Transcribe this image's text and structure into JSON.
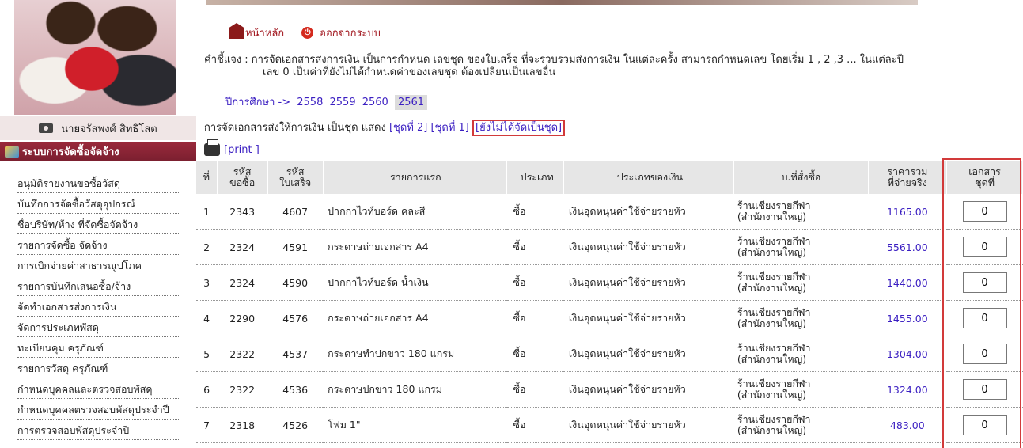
{
  "left": {
    "username": "นายจรัสพงศ์ สิทธิโสต",
    "menu_header": "ระบบการจัดซื้อจัดจ้าง",
    "menu": [
      "อนุมัติรายงานขอซื้อวัสดุ",
      "บันทึกการจัดซื้อวัสดุอุปกรณ์",
      "ชื่อบริษัท/ห้าง ที่จัดซื้อจัดจ้าง",
      "รายการจัดซื้อ จัดจ้าง",
      "การเบิกจ่ายค่าสาธารณูปโภค",
      "รายการบันทึกเสนอซื้อ/จ้าง",
      "จัดทำเอกสารส่งการเงิน",
      "จัดการประเภทพัสดุ",
      "ทะเบียนคุม ครุภัณฑ์",
      "รายการวัสดุ ครุภัณฑ์",
      "กำหนดบุคคลและตรวจสอบพัสดุ",
      "กำหนดบุคคลตรวจสอบพัสดุประจำปี",
      "การตรวจสอบพัสดุประจำปี"
    ]
  },
  "topnav": {
    "home": "หน้าหลัก",
    "logout": "ออกจากระบบ"
  },
  "explain": {
    "line1": "คำชี้แจง : การจัดเอกสารส่งการเงิน เป็นการกำหนด เลขชุด ของใบเสร็จ ที่จะรวบรวมส่งการเงิน ในแต่ละครั้ง สามารถกำหนดเลข โดยเริ่ม 1 , 2 ,3 ... ในแต่ละปี",
    "line2": "เลข 0 เป็นค่าที่ยังไม่ได้กำหนดค่าของเลขชุด ต้องเปลี่ยนเป็นเลขอื่น"
  },
  "years": {
    "label": "ปีการศึกษา ->",
    "items": [
      "2558",
      "2559",
      "2560",
      "2561"
    ],
    "active": "2561"
  },
  "group": {
    "text": "การจัดเอกสารส่งให้การเงิน เป็นชุด แสดง",
    "set2": "[ชุดที่ 2]",
    "set1": "[ชุดที่ 1]",
    "unassigned": "[ยังไม่ได้จัดเป็นชุด]"
  },
  "print_label": "[print ]",
  "table": {
    "headers": {
      "no": "ที่",
      "req_1": "รหัส",
      "req_2": "ขอซื้อ",
      "rec_1": "รหัส",
      "rec_2": "ใบเสร็จ",
      "item": "รายการแรก",
      "type": "ประเภท",
      "money": "ประเภทของเงิน",
      "shop": "บ.ที่สั่งซื้อ",
      "price_1": "ราคารวม",
      "price_2": "ที่จ่ายจริง",
      "doc_1": "เอกสาร",
      "doc_2": "ชุดที่"
    },
    "rows": [
      {
        "no": "1",
        "req": "2343",
        "rec": "4607",
        "item": "ปากกาไวท์บอร์ด คละสี",
        "type": "ซื้อ",
        "money": "เงินอุดหนุนค่าใช้จ่ายรายหัว",
        "shop_1": "ร้านเชียงรายกีฬา",
        "shop_2": "(สำนักงานใหญ่)",
        "price": "1165.00",
        "doc": "0"
      },
      {
        "no": "2",
        "req": "2324",
        "rec": "4591",
        "item": "กระดาษถ่ายเอกสาร A4",
        "type": "ซื้อ",
        "money": "เงินอุดหนุนค่าใช้จ่ายรายหัว",
        "shop_1": "ร้านเชียงรายกีฬา",
        "shop_2": "(สำนักงานใหญ่)",
        "price": "5561.00",
        "doc": "0"
      },
      {
        "no": "3",
        "req": "2324",
        "rec": "4590",
        "item": "ปากกาไวท์บอร์ด น้ำเงิน",
        "type": "ซื้อ",
        "money": "เงินอุดหนุนค่าใช้จ่ายรายหัว",
        "shop_1": "ร้านเชียงรายกีฬา",
        "shop_2": "(สำนักงานใหญ่)",
        "price": "1440.00",
        "doc": "0"
      },
      {
        "no": "4",
        "req": "2290",
        "rec": "4576",
        "item": "กระดาษถ่ายเอกสาร A4",
        "type": "ซื้อ",
        "money": "เงินอุดหนุนค่าใช้จ่ายรายหัว",
        "shop_1": "ร้านเชียงรายกีฬา",
        "shop_2": "(สำนักงานใหญ่)",
        "price": "1455.00",
        "doc": "0"
      },
      {
        "no": "5",
        "req": "2322",
        "rec": "4537",
        "item": "กระดาษทำปกขาว 180 แกรม",
        "type": "ซื้อ",
        "money": "เงินอุดหนุนค่าใช้จ่ายรายหัว",
        "shop_1": "ร้านเชียงรายกีฬา",
        "shop_2": "(สำนักงานใหญ่)",
        "price": "1304.00",
        "doc": "0"
      },
      {
        "no": "6",
        "req": "2322",
        "rec": "4536",
        "item": "กระดาษปกขาว 180 แกรม",
        "type": "ซื้อ",
        "money": "เงินอุดหนุนค่าใช้จ่ายรายหัว",
        "shop_1": "ร้านเชียงรายกีฬา",
        "shop_2": "(สำนักงานใหญ่)",
        "price": "1324.00",
        "doc": "0"
      },
      {
        "no": "7",
        "req": "2318",
        "rec": "4526",
        "item": "โฟม 1\"",
        "type": "ซื้อ",
        "money": "เงินอุดหนุนค่าใช้จ่ายรายหัว",
        "shop_1": "ร้านเชียงรายกีฬา",
        "shop_2": "(สำนักงานใหญ่)",
        "price": "483.00",
        "doc": "0"
      }
    ]
  }
}
